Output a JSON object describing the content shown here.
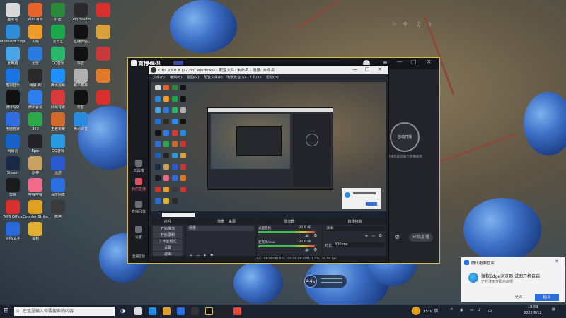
{
  "desktop": {
    "icons": [
      {
        "label": "回收站",
        "color": "#d9d9d9"
      },
      {
        "label": "Microsoft Edge",
        "color": "#2d8bd8"
      },
      {
        "label": "此电脑",
        "color": "#4aa4e8"
      },
      {
        "label": "酷狗音乐",
        "color": "#1b74e4"
      },
      {
        "label": "腾讯QQ",
        "color": "#111111"
      },
      {
        "label": "电脑管家",
        "color": "#2f6ee0"
      },
      {
        "label": "网易云",
        "color": "#1462c8"
      },
      {
        "label": "Steam",
        "color": "#1b2a44"
      },
      {
        "label": "剪映",
        "color": "#1b1b1b"
      },
      {
        "label": "WPS Office",
        "color": "#d8302c"
      },
      {
        "label": "WPS文字",
        "color": "#2a6ad8"
      },
      {
        "label": "WPS演示",
        "color": "#e8622c"
      },
      {
        "label": "火绒",
        "color": "#f09a2a"
      },
      {
        "label": "迅雷",
        "color": "#2a7ae0"
      },
      {
        "label": "网易UU",
        "color": "#2a2a2a"
      },
      {
        "label": "腾讯会议",
        "color": "#2f7ef0"
      },
      {
        "label": "360",
        "color": "#2aa84a"
      },
      {
        "label": "Epic",
        "color": "#222222"
      },
      {
        "label": "原神",
        "color": "#c8a060"
      },
      {
        "label": "哔哩哔哩",
        "color": "#f06a8a"
      },
      {
        "label": "Counter-Strike",
        "color": "#e0a020"
      },
      {
        "label": "福利",
        "color": "#e0b030"
      },
      {
        "label": "好压",
        "color": "#2a8a3a"
      },
      {
        "label": "爱奇艺",
        "color": "#1aa84a"
      },
      {
        "label": "QQ音乐",
        "color": "#29b86a"
      },
      {
        "label": "腾讯视频",
        "color": "#1e90ff"
      },
      {
        "label": "网易有道",
        "color": "#d83a3a"
      },
      {
        "label": "王者荣耀",
        "color": "#d06a2a"
      },
      {
        "label": "QQ游戏",
        "color": "#2a9ae0"
      },
      {
        "label": "迅游",
        "color": "#2a5ad0"
      },
      {
        "label": "百度网盘",
        "color": "#2a6ee0"
      },
      {
        "label": "微信",
        "color": "#3a3a3a"
      },
      {
        "label": "OBS Studio",
        "color": "#2a2a2a"
      },
      {
        "label": "直播伴侣",
        "color": "#111111"
      },
      {
        "label": "抖音",
        "color": "#111111"
      },
      {
        "label": "和平精英",
        "color": "#b0b0b0"
      },
      {
        "label": "抖音",
        "color": "#111111"
      },
      {
        "label": "腾讯课堂",
        "color": "#2a8ae0"
      },
      {
        "label": "",
        "color": "#d8302c"
      },
      {
        "label": "",
        "color": "#d8a03a"
      },
      {
        "label": "",
        "color": "#c83a3a"
      },
      {
        "label": "",
        "color": "#e07a2a"
      },
      {
        "label": "",
        "color": "#d8302c"
      }
    ]
  },
  "streaming_app": {
    "brand": "直播伴侣",
    "sidebar": [
      "工具箱",
      "我的直播",
      "直播回放",
      "设置"
    ],
    "exit_label": "退出",
    "start_circle": "自动开播",
    "tip": "开播后即可展示直播画面",
    "start_button": "开始直播",
    "bottom_label": "直播回放"
  },
  "obs": {
    "title": "OBS 25.0.8 (32 bit, windows) - 配置文件: 未命名 - 场景: 未命名",
    "menu": [
      "文件(F)",
      "编辑(E)",
      "视图(V)",
      "配置文件(P)",
      "场景集合(S)",
      "工具(T)",
      "帮助(H)"
    ],
    "panels": {
      "controls": "控件",
      "scenes": "场景",
      "sources": "来源",
      "mixer": "混音器",
      "transitions": "转场特效"
    },
    "buttons": [
      "开始推流",
      "开始录制",
      "工作室模式",
      "设置",
      "退出"
    ],
    "scene_name": "场景",
    "mixer_tracks": [
      {
        "name": "桌面音频",
        "level": "-21.0 dB"
      },
      {
        "name": "麦克风/Aux",
        "level": "-21.0 dB"
      }
    ],
    "transition": "淡出",
    "duration_label": "时长",
    "duration_value": "300 ms",
    "status": "LIVE: 00:00:00   REC: 00:00:00   CPU: 1.5%, 30.00 fps"
  },
  "taskbar": {
    "search_placeholder": "在这里输入你要搜索的内容",
    "weather": "35°C 阴",
    "time": "19:59",
    "date": "2022/6/12",
    "lang": "中"
  },
  "notification": {
    "header": "腾讯电脑管家",
    "title": "微软Edge浏览器 试图开机自启",
    "subtitle": "正在注册开机自启项",
    "allow": "允许",
    "block": "阻止"
  },
  "bubble": {
    "value": "44",
    "unit": "%"
  }
}
